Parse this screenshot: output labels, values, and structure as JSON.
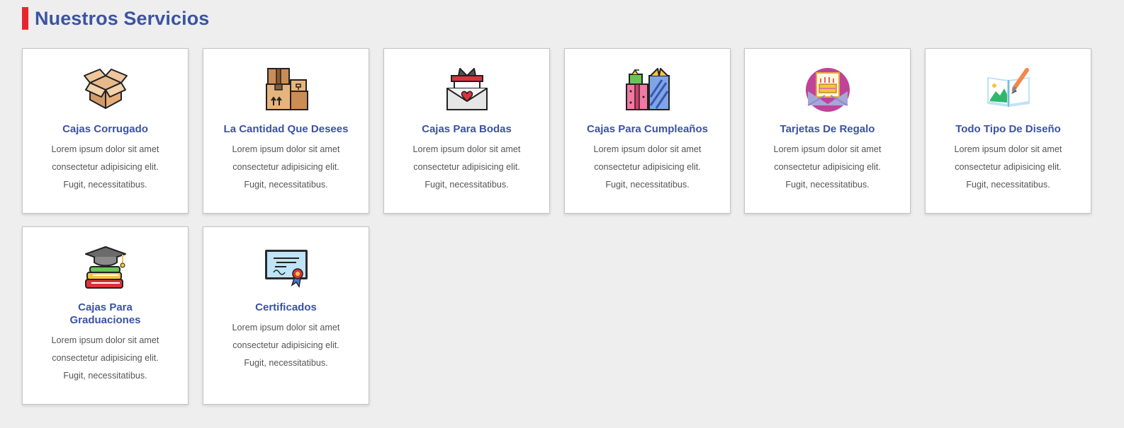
{
  "section": {
    "title": "Nuestros Servicios"
  },
  "services": [
    {
      "title": "Cajas Corrugado",
      "icon": "open-box-icon",
      "desc_lines": [
        "Lorem ipsum dolor sit amet",
        "consectetur adipisicing elit.",
        "Fugit, necessitatibus."
      ]
    },
    {
      "title": "La Cantidad Que Desees",
      "icon": "stacked-boxes-icon",
      "desc_lines": [
        "Lorem ipsum dolor sit amet",
        "consectetur adipisicing elit.",
        "Fugit, necessitatibus."
      ]
    },
    {
      "title": "Cajas Para Bodas",
      "icon": "wedding-envelope-gift-icon",
      "desc_lines": [
        "Lorem ipsum dolor sit amet",
        "consectetur adipisicing elit.",
        "Fugit, necessitatibus."
      ]
    },
    {
      "title": "Cajas Para Cumpleaños",
      "icon": "gift-boxes-icon",
      "desc_lines": [
        "Lorem ipsum dolor sit amet",
        "consectetur adipisicing elit.",
        "Fugit, necessitatibus."
      ]
    },
    {
      "title": "Tarjetas De Regalo",
      "icon": "birthday-card-icon",
      "desc_lines": [
        "Lorem ipsum dolor sit amet",
        "consectetur adipisicing elit.",
        "Fugit, necessitatibus."
      ]
    },
    {
      "title": "Todo Tipo De Diseño",
      "icon": "design-book-brush-icon",
      "desc_lines": [
        "Lorem ipsum dolor sit amet",
        "consectetur adipisicing elit.",
        "Fugit, necessitatibus."
      ]
    },
    {
      "title": "Cajas Para Graduaciones",
      "icon": "graduation-cap-books-icon",
      "desc_lines": [
        "Lorem ipsum dolor sit amet",
        "consectetur adipisicing elit.",
        "Fugit, necessitatibus."
      ]
    },
    {
      "title": "Certificados",
      "icon": "certificate-icon",
      "desc_lines": [
        "Lorem ipsum dolor sit amet",
        "consectetur adipisicing elit.",
        "Fugit, necessitatibus."
      ]
    }
  ],
  "colors": {
    "accent_bar": "#e8252e",
    "title_blue": "#3a53a4",
    "background": "#eeeeee",
    "card_bg": "#ffffff"
  }
}
